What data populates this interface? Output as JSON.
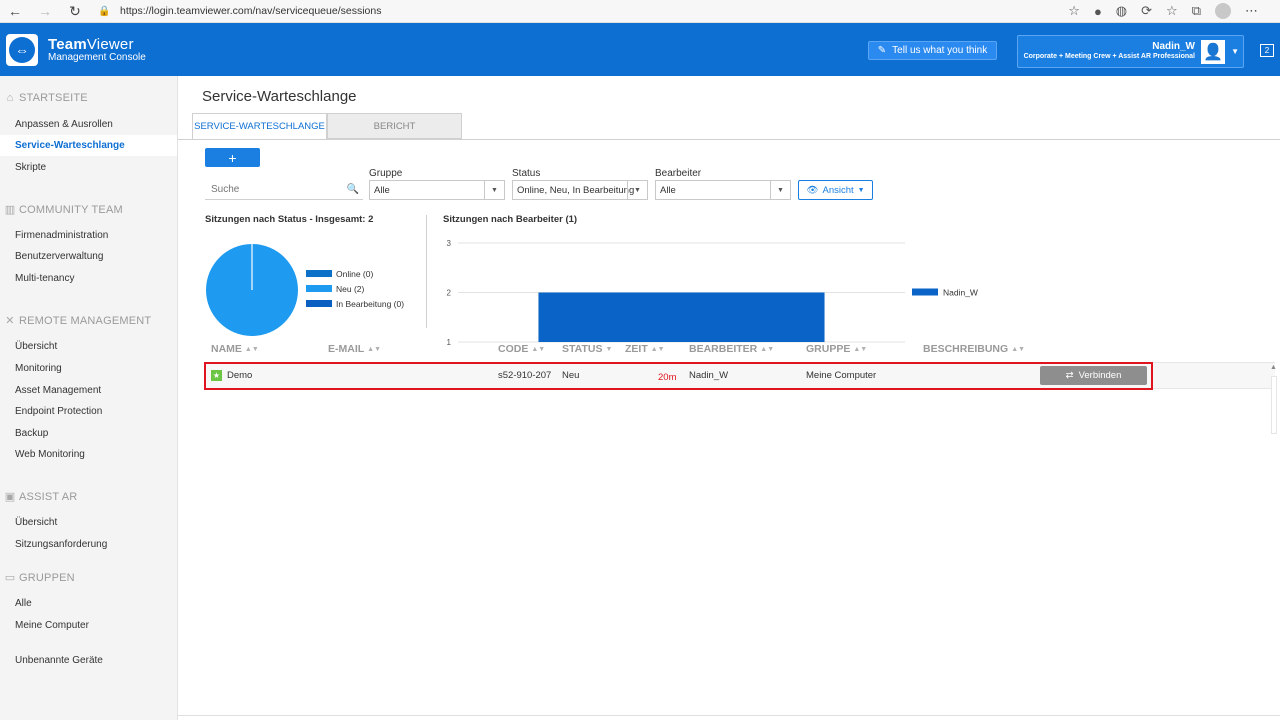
{
  "browser": {
    "url": "https://login.teamviewer.com/nav/servicequeue/sessions"
  },
  "header": {
    "brand_bold": "Team",
    "brand_rest": "Viewer",
    "subtitle": "Management Console",
    "feedback_label": "Tell us what you think",
    "user_name": "Nadin_W",
    "license": "Corporate + Meeting Crew + Assist AR Professional",
    "notifications": "2"
  },
  "sidebar": {
    "sections": [
      {
        "title": "STARTSEITE",
        "icon": "home-icon"
      },
      {
        "title": "COMMUNITY TEAM",
        "icon": "building-icon"
      },
      {
        "title": "REMOTE MANAGEMENT",
        "icon": "tools-icon"
      },
      {
        "title": "ASSIST AR",
        "icon": "ar-icon"
      },
      {
        "title": "GRUPPEN",
        "icon": "folder-icon"
      }
    ],
    "items": [
      "Anpassen & Ausrollen",
      "Service-Warteschlange",
      "Skripte",
      "Firmenadministration",
      "Benutzerverwaltung",
      "Multi-tenancy",
      "Übersicht",
      "Monitoring",
      "Asset Management",
      "Endpoint Protection",
      "Backup",
      "Web Monitoring",
      "Übersicht",
      "Sitzungsanforderung",
      "Alle",
      "Meine Computer",
      "Unbenannte Geräte"
    ]
  },
  "main": {
    "title": "Service-Warteschlange",
    "tabs": [
      "SERVICE-WARTESCHLANGE",
      "BERICHT"
    ],
    "add_label": "+",
    "search_placeholder": "Suche",
    "filters": {
      "group_label": "Gruppe",
      "group_value": "Alle",
      "status_label": "Status",
      "status_value": "Online, Neu, In Bearbeitung",
      "assignee_label": "Bearbeiter",
      "assignee_value": "Alle",
      "view_label": "Ansicht"
    },
    "table": {
      "headers": [
        "NAME",
        "E-MAIL",
        "CODE",
        "STATUS",
        "ZEIT",
        "BEARBEITER",
        "GRUPPE",
        "BESCHREIBUNG"
      ],
      "rows": [
        {
          "name": "Demo",
          "email": "",
          "code": "s52-910-207",
          "status": "Neu",
          "time": "20m",
          "assignee": "Nadin_W",
          "group": "Meine Computer",
          "description": "",
          "action": "Verbinden"
        }
      ]
    }
  },
  "colors": {
    "brand": "#0e6fd3",
    "pie": "#1e9bf0",
    "bar": "#0a64c8",
    "highlight": "#e0141e"
  },
  "chart_data": [
    {
      "type": "pie",
      "title": "Sitzungen nach Status - Insgesamt: 2",
      "categories": [
        "Online (0)",
        "Neu (2)",
        "In Bearbeitung (0)"
      ],
      "values": [
        0,
        2,
        0
      ],
      "colors": [
        "#0a70c8",
        "#1e9bf0",
        "#0a5fc0"
      ],
      "legend": "right"
    },
    {
      "type": "bar",
      "title": "Sitzungen nach Bearbeiter (1)",
      "categories": [
        "Nadin_W"
      ],
      "series": [
        {
          "name": "Nadin_W",
          "values": [
            2
          ]
        }
      ],
      "yticks": [
        "1",
        "2",
        "3"
      ],
      "ylim": [
        1,
        3
      ],
      "legend": "right",
      "grid": true
    }
  ]
}
